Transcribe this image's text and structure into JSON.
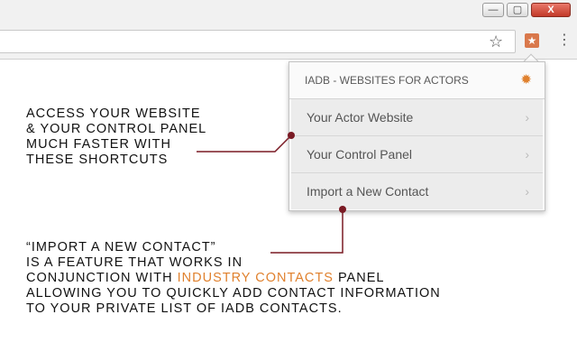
{
  "window": {
    "minimize": "—",
    "maximize": "▢",
    "close": "X"
  },
  "toolbar": {
    "star": "☆",
    "menu": "⋮"
  },
  "popup": {
    "title": "IADB - WEBSITES FOR ACTORS",
    "items": [
      {
        "label": "Your Actor Website"
      },
      {
        "label": "Your Control Panel"
      },
      {
        "label": "Import a New Contact"
      }
    ]
  },
  "callout1": {
    "lines": [
      "ACCESS YOUR WEBSITE",
      "& YOUR CONTROL PANEL",
      "MUCH FASTER WITH",
      "THESE SHORTCUTS"
    ]
  },
  "callout2": {
    "line1": "“IMPORT A NEW CONTACT”",
    "line2": "IS A FEATURE THAT WORKS IN",
    "line3_pre": "CONJUNCTION WITH ",
    "line3_highlight": "INDUSTRY CONTACTS",
    "line3_post": " PANEL",
    "line4": "ALLOWING YOU TO QUICKLY ADD CONTACT INFORMATION",
    "line5": "TO YOUR PRIVATE LIST OF IADB CONTACTS."
  },
  "colors": {
    "accent": "#e0812e",
    "connector": "#7a1a24"
  },
  "icons": [
    "star-icon",
    "extension-icon",
    "menu-icon",
    "gear-icon",
    "chevron-right-icon"
  ]
}
